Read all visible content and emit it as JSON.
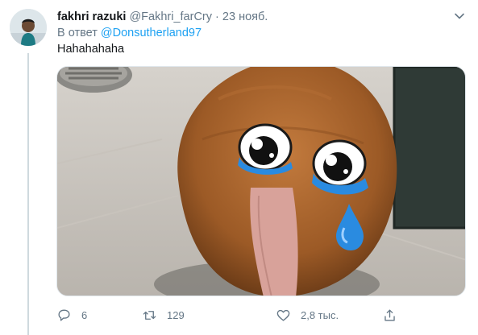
{
  "tweet": {
    "author_name": "fakhri razuki",
    "author_handle": "@Fakhri_farCry",
    "separator": "·",
    "date": "23 нояб.",
    "reply_prefix": "В ответ",
    "reply_to": "@Donsutherland97",
    "text": "Hahahahaha"
  },
  "media": {
    "icon": "kiwi-bird-video-thumbnail"
  },
  "actions": {
    "reply_count": "6",
    "retweet_count": "129",
    "like_count": "2,8 тыс."
  },
  "colors": {
    "link": "#1da1f2",
    "secondary_text": "#657786",
    "primary_text": "#14171a"
  }
}
